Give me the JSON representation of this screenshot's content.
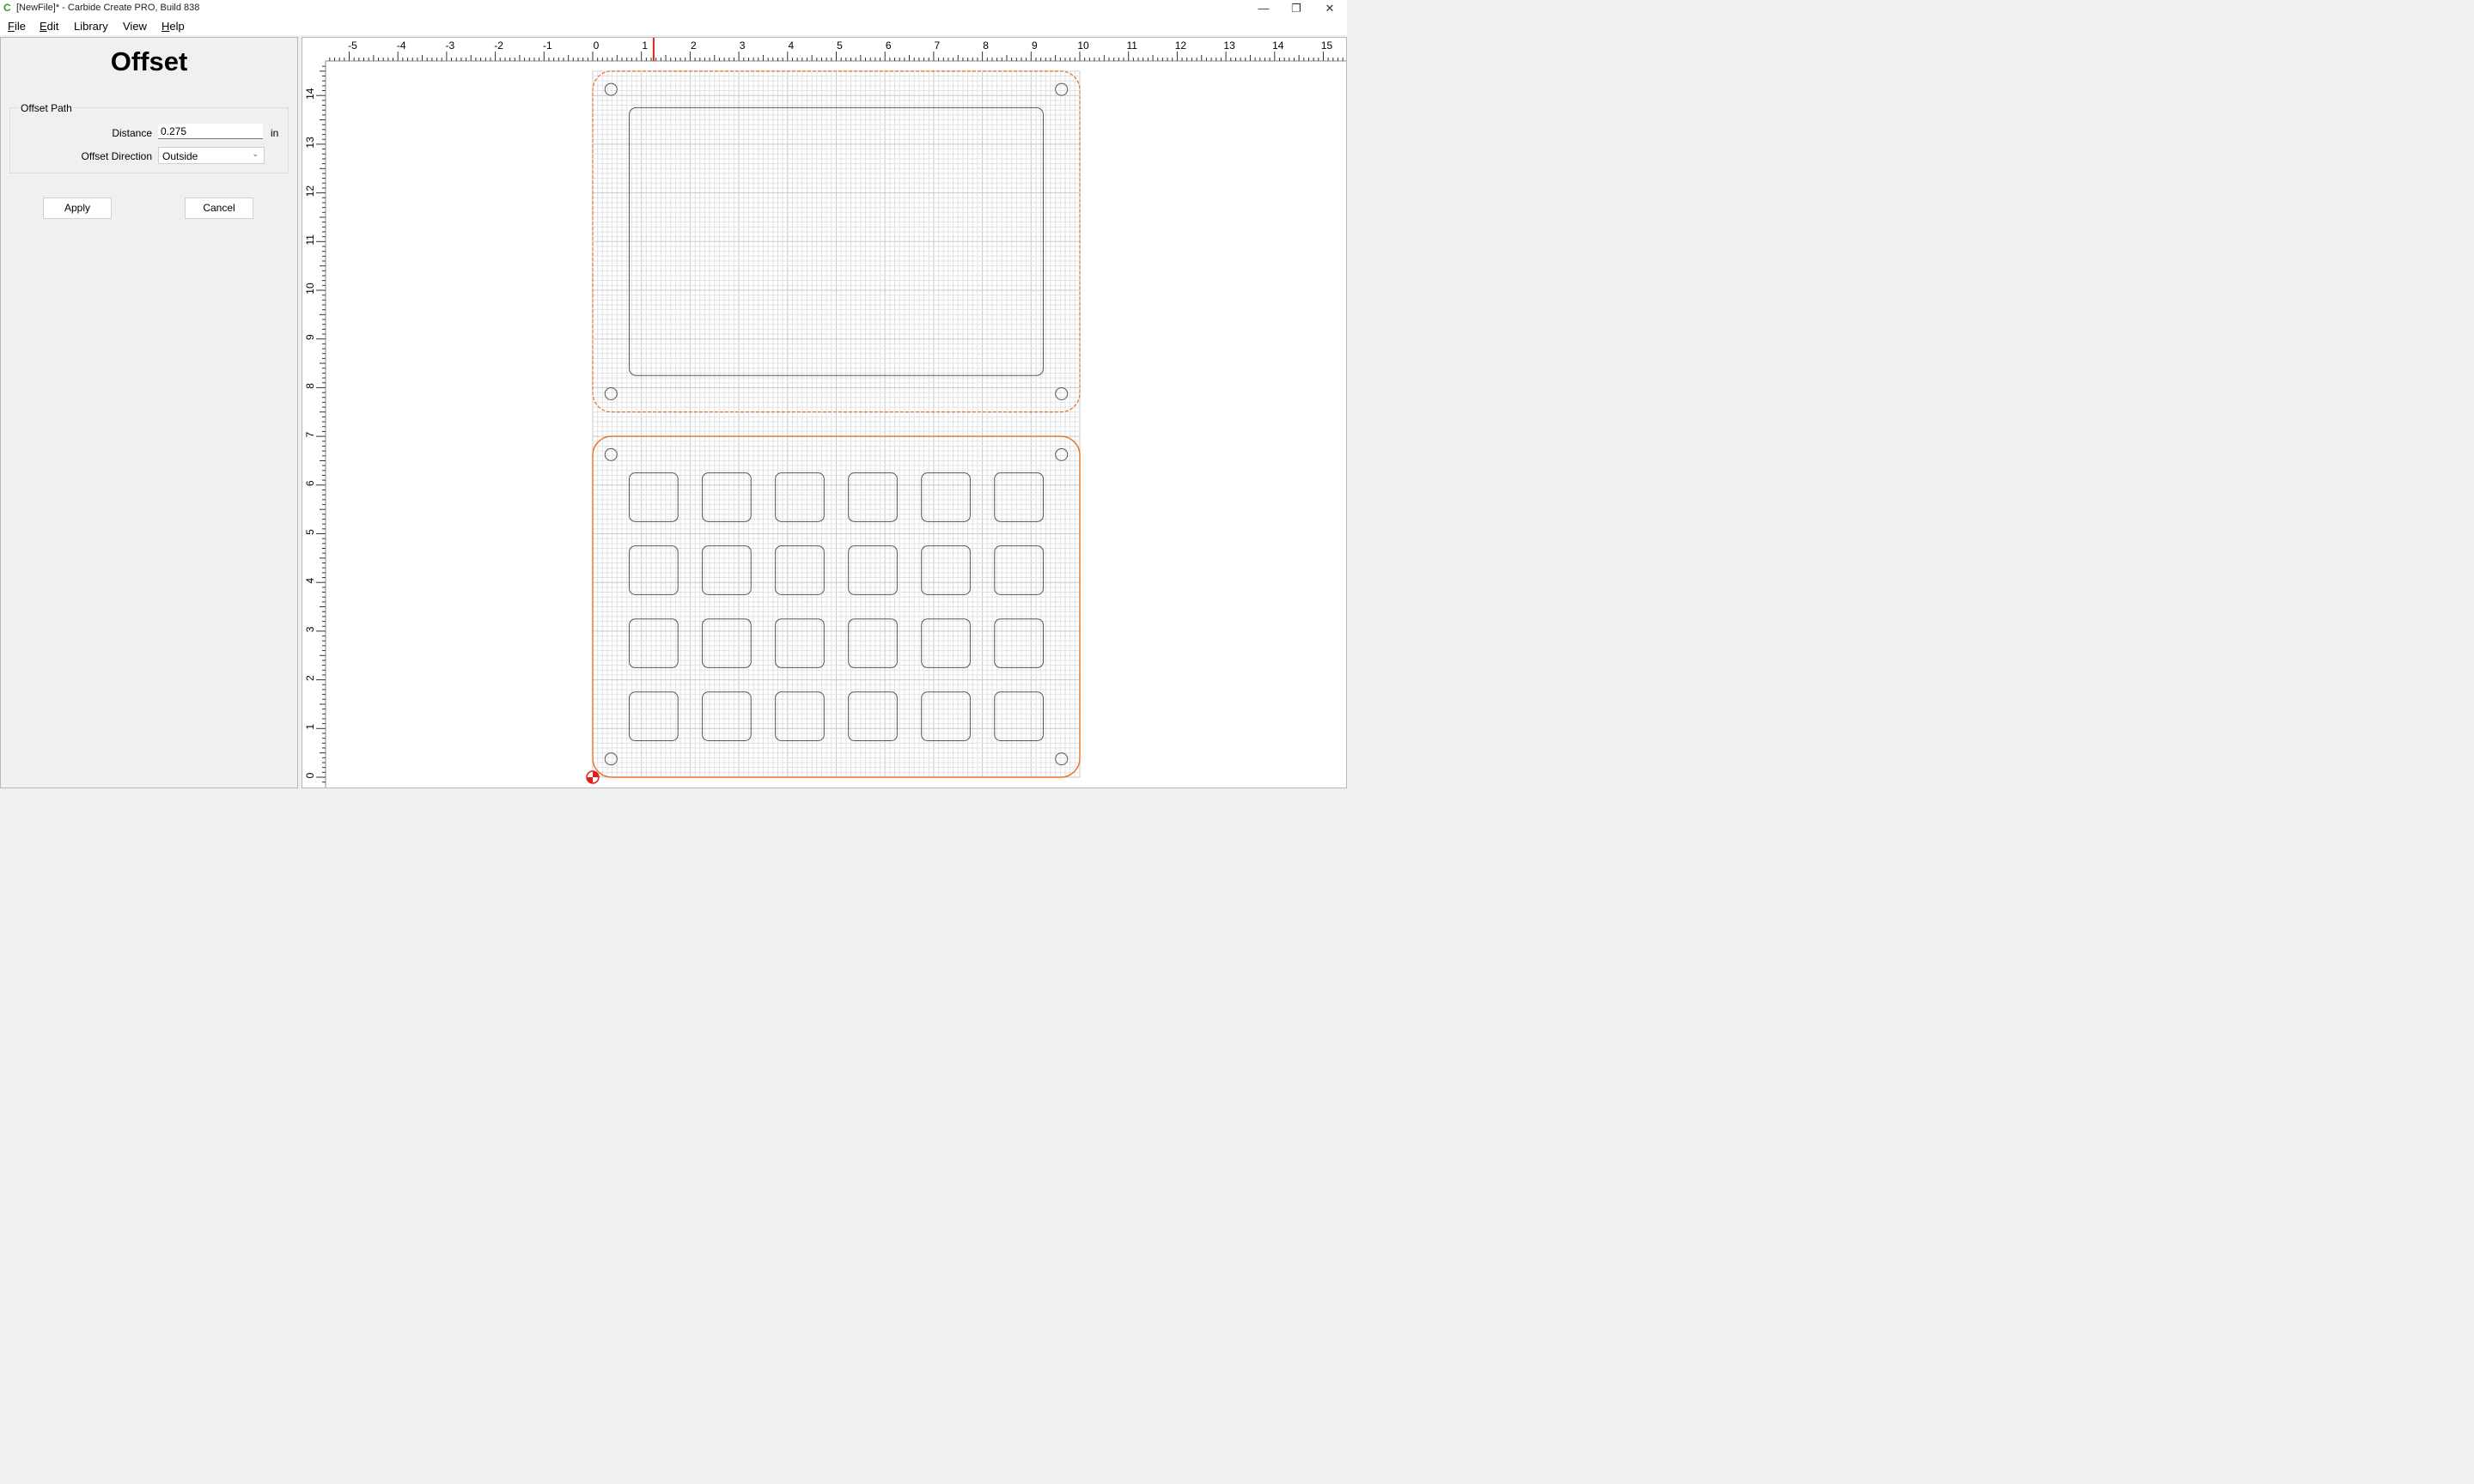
{
  "window": {
    "title": "[NewFile]* - Carbide Create PRO, Build 838",
    "app_icon": "carbide-c-icon",
    "controls": {
      "minimize": "—",
      "restore": "❐",
      "close": "✕"
    }
  },
  "menu": [
    {
      "mnemonic": "F",
      "rest": "ile"
    },
    {
      "mnemonic": "E",
      "rest": "dit"
    },
    {
      "mnemonic": "",
      "rest": "Library"
    },
    {
      "mnemonic": "",
      "rest": "View"
    },
    {
      "mnemonic": "H",
      "rest": "elp"
    }
  ],
  "panel": {
    "title": "Offset",
    "group_label": "Offset Path",
    "distance_label": "Distance",
    "distance_value": "0.275",
    "distance_unit": "in",
    "direction_label": "Offset Direction",
    "direction_value": "Outside",
    "apply_label": "Apply",
    "cancel_label": "Cancel"
  },
  "canvas": {
    "top_ruler_labels": [
      "-5",
      "-4",
      "-3",
      "-2",
      "-1",
      "0",
      "1",
      "2",
      "3",
      "4",
      "5",
      "6",
      "7",
      "8",
      "9",
      "10",
      "11",
      "12",
      "13",
      "14",
      "15"
    ],
    "left_ruler_labels": [
      "0",
      "1",
      "2",
      "3",
      "4",
      "5",
      "6",
      "7",
      "8",
      "9",
      "10",
      "11",
      "12",
      "13",
      "14"
    ],
    "cursor_x_in": 1.25,
    "colors": {
      "offset_path": "#e8731e",
      "shape_stroke": "#555555",
      "grid_minor": "#e2e2e2",
      "grid_major": "#c8c8c8",
      "cursor_marker": "#e0201c"
    }
  }
}
